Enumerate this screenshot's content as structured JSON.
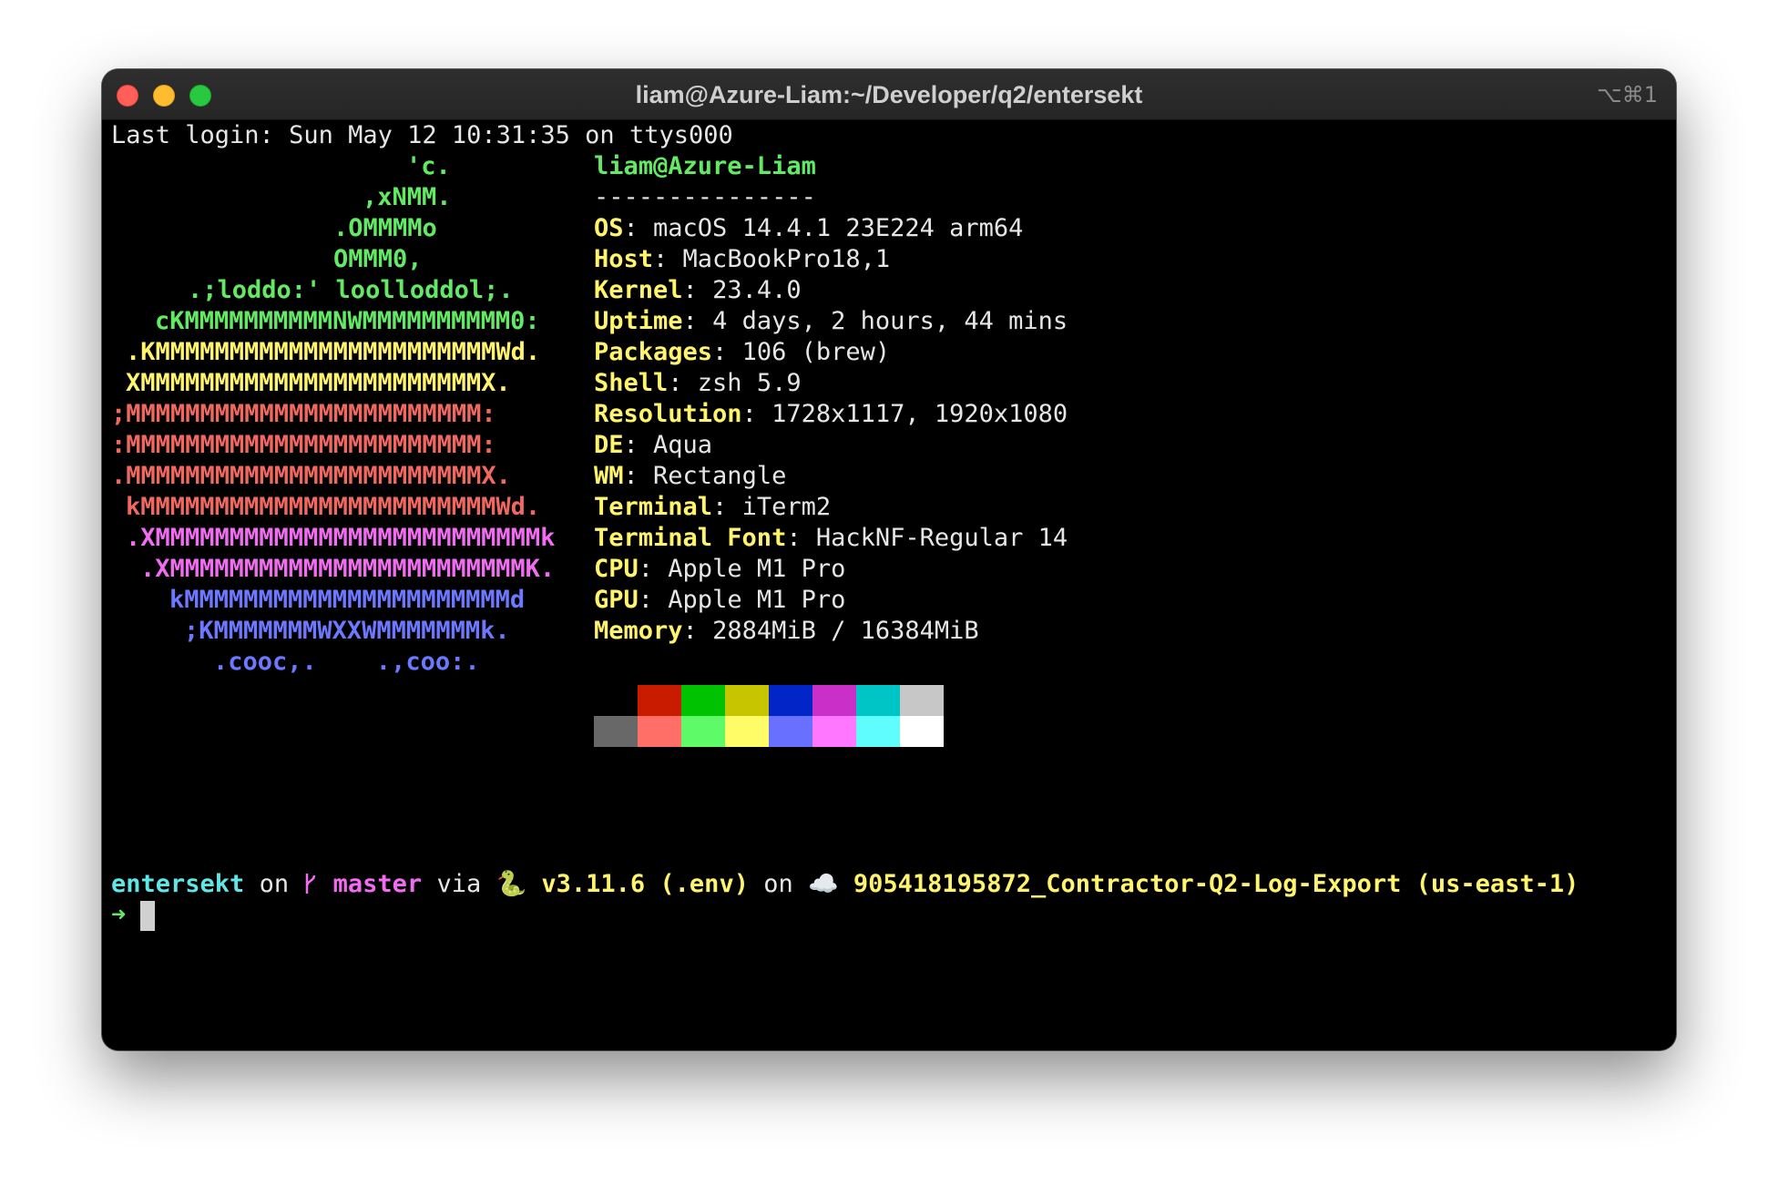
{
  "window": {
    "title": "liam@Azure-Liam:~/Developer/q2/entersekt",
    "shortcut": "⌥⌘1"
  },
  "last_login": "Last login: Sun May 12 10:31:35 on ttys000",
  "logo_lines": [
    {
      "text": "'c.",
      "color": "green"
    },
    {
      "text": ",xNMM.",
      "color": "green"
    },
    {
      "text": ".OMMMMo",
      "color": "green"
    },
    {
      "text": "OMMM0,",
      "color": "green"
    },
    {
      "text": ".;loddo:' loolloddol;.",
      "color": "green"
    },
    {
      "text": "cKMMMMMMMMMMNWMMMMMMMMMM0:",
      "color": "green"
    },
    {
      "text": ".KMMMMMMMMMMMMMMMMMMMMMMMWd.",
      "color": "yellow"
    },
    {
      "text": "XMMMMMMMMMMMMMMMMMMMMMMMX.",
      "color": "yellow"
    },
    {
      "text": ";MMMMMMMMMMMMMMMMMMMMMMMM:",
      "color": "red"
    },
    {
      "text": ":MMMMMMMMMMMMMMMMMMMMMMMM:",
      "color": "red"
    },
    {
      "text": ".MMMMMMMMMMMMMMMMMMMMMMMMX.",
      "color": "red"
    },
    {
      "text": "kMMMMMMMMMMMMMMMMMMMMMMMMWd.",
      "color": "red"
    },
    {
      "text": ".XMMMMMMMMMMMMMMMMMMMMMMMMMMk",
      "color": "magenta"
    },
    {
      "text": ".XMMMMMMMMMMMMMMMMMMMMMMMMK.",
      "color": "magenta"
    },
    {
      "text": "kMMMMMMMMMMMMMMMMMMMMMMd",
      "color": "blue"
    },
    {
      "text": ";KMMMMMMMWXXWMMMMMMMk.",
      "color": "blue"
    },
    {
      "text": ".cooc,.    .,coo:.",
      "color": "blue"
    }
  ],
  "userhost": "liam@Azure-Liam",
  "separator": "---------------",
  "info": [
    {
      "label": "OS",
      "value": "macOS 14.4.1 23E224 arm64"
    },
    {
      "label": "Host",
      "value": "MacBookPro18,1"
    },
    {
      "label": "Kernel",
      "value": "23.4.0"
    },
    {
      "label": "Uptime",
      "value": "4 days, 2 hours, 44 mins"
    },
    {
      "label": "Packages",
      "value": "106 (brew)"
    },
    {
      "label": "Shell",
      "value": "zsh 5.9"
    },
    {
      "label": "Resolution",
      "value": "1728x1117, 1920x1080"
    },
    {
      "label": "DE",
      "value": "Aqua"
    },
    {
      "label": "WM",
      "value": "Rectangle"
    },
    {
      "label": "Terminal",
      "value": "iTerm2"
    },
    {
      "label": "Terminal Font",
      "value": "HackNF-Regular 14"
    },
    {
      "label": "CPU",
      "value": "Apple M1 Pro"
    },
    {
      "label": "GPU",
      "value": "Apple M1 Pro"
    },
    {
      "label": "Memory",
      "value": "2884MiB / 16384MiB"
    }
  ],
  "palette": {
    "normal": [
      "#000000",
      "#c91b00",
      "#00c200",
      "#c7c400",
      "#0225c7",
      "#ca30c7",
      "#00c5c7",
      "#c7c7c7"
    ],
    "bright": [
      "#686868",
      "#ff6e67",
      "#5ffa68",
      "#fffc67",
      "#6871ff",
      "#ff77ff",
      "#60fdff",
      "#ffffff"
    ]
  },
  "prompt": {
    "directory": "entersekt",
    "on1": "on",
    "branch_icon": "",
    "branch": "master",
    "via": "via",
    "python_icon": "🐍",
    "python_version": "v3.11.6 (.env)",
    "on2": "on",
    "cloud_icon": "☁️",
    "aws_profile": "905418195872_Contractor-Q2-Log-Export (us-east-1)",
    "arrow": "➜"
  }
}
